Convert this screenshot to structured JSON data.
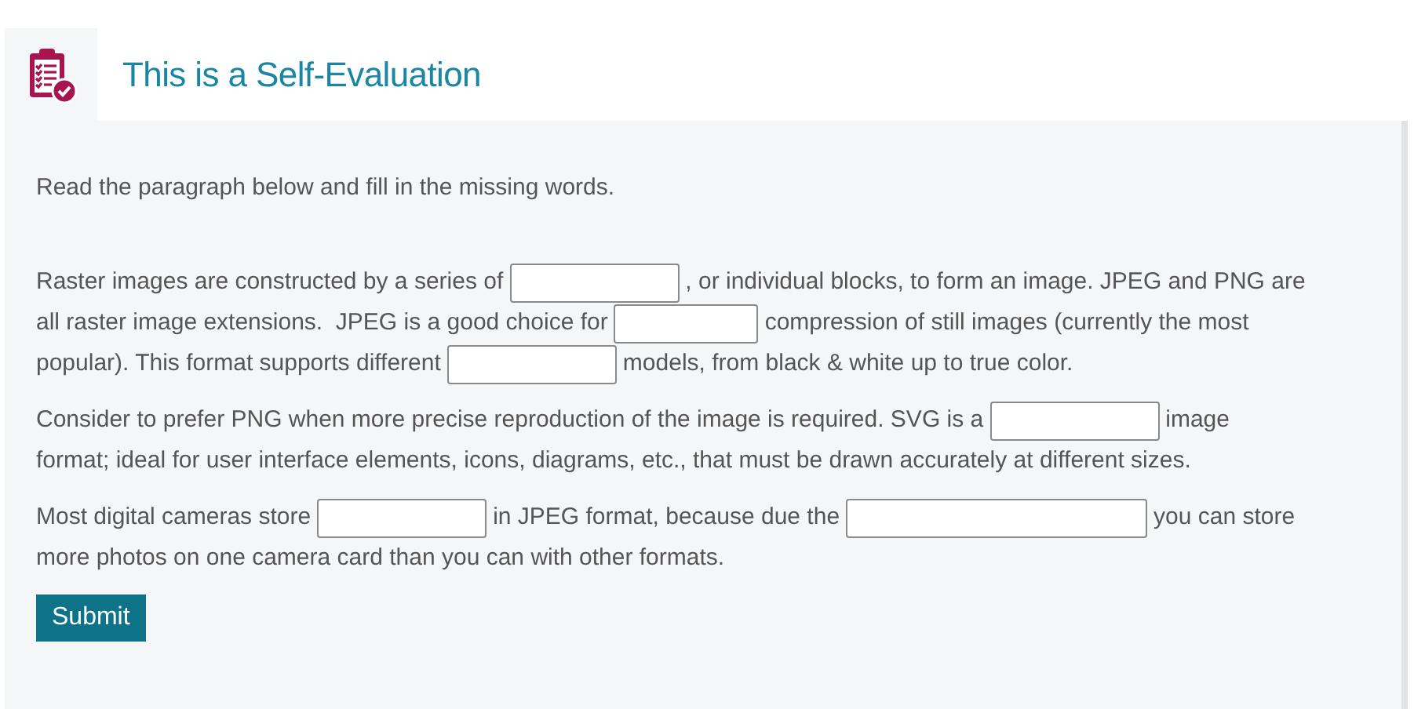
{
  "header": {
    "title": "This is a Self-Evaluation"
  },
  "instructions": "Read the paragraph below and fill in the missing words.",
  "paragraphs": [
    {
      "lines": [
        [
          {
            "kind": "text",
            "text": "Raster images are constructed by a series of"
          },
          {
            "kind": "blank"
          },
          {
            "kind": "text",
            "text": ", or individual blocks, to form an image. JPEG and PNG are"
          }
        ],
        [
          {
            "kind": "text",
            "text": "all raster image extensions.  JPEG is a good choice for"
          },
          {
            "kind": "blank"
          },
          {
            "kind": "text",
            "text": "compression of still images (currently the most"
          }
        ],
        [
          {
            "kind": "text",
            "text": "popular). This format supports different"
          },
          {
            "kind": "blank"
          },
          {
            "kind": "text",
            "text": "models, from black & white up to true color."
          }
        ]
      ]
    },
    {
      "lines": [
        [
          {
            "kind": "text",
            "text": "Consider to prefer PNG when more precise reproduction of the image is required. SVG is a"
          },
          {
            "kind": "blank"
          },
          {
            "kind": "text",
            "text": "image"
          }
        ],
        [
          {
            "kind": "text",
            "text": "format; ideal for user interface elements, icons, diagrams, etc., that must be drawn accurately at different sizes."
          }
        ]
      ]
    },
    {
      "lines": [
        [
          {
            "kind": "text",
            "text": "Most digital cameras store"
          },
          {
            "kind": "blank"
          },
          {
            "kind": "text",
            "text": "in JPEG format, because due the"
          },
          {
            "kind": "blank"
          },
          {
            "kind": "text",
            "text": "you can store"
          }
        ],
        [
          {
            "kind": "text",
            "text": "more photos on one camera card than you can with other formats."
          }
        ]
      ]
    }
  ],
  "submit": "Submit"
}
